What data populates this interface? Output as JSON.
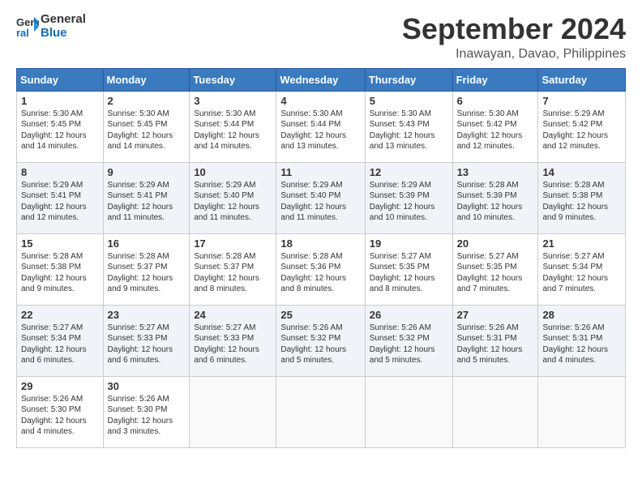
{
  "logo": {
    "line1": "General",
    "line2": "Blue"
  },
  "header": {
    "title": "September 2024",
    "location": "Inawayan, Davao, Philippines"
  },
  "days_of_week": [
    "Sunday",
    "Monday",
    "Tuesday",
    "Wednesday",
    "Thursday",
    "Friday",
    "Saturday"
  ],
  "weeks": [
    [
      {
        "day": "1",
        "info": "Sunrise: 5:30 AM\nSunset: 5:45 PM\nDaylight: 12 hours\nand 14 minutes."
      },
      {
        "day": "2",
        "info": "Sunrise: 5:30 AM\nSunset: 5:45 PM\nDaylight: 12 hours\nand 14 minutes."
      },
      {
        "day": "3",
        "info": "Sunrise: 5:30 AM\nSunset: 5:44 PM\nDaylight: 12 hours\nand 14 minutes."
      },
      {
        "day": "4",
        "info": "Sunrise: 5:30 AM\nSunset: 5:44 PM\nDaylight: 12 hours\nand 13 minutes."
      },
      {
        "day": "5",
        "info": "Sunrise: 5:30 AM\nSunset: 5:43 PM\nDaylight: 12 hours\nand 13 minutes."
      },
      {
        "day": "6",
        "info": "Sunrise: 5:30 AM\nSunset: 5:42 PM\nDaylight: 12 hours\nand 12 minutes."
      },
      {
        "day": "7",
        "info": "Sunrise: 5:29 AM\nSunset: 5:42 PM\nDaylight: 12 hours\nand 12 minutes."
      }
    ],
    [
      {
        "day": "8",
        "info": "Sunrise: 5:29 AM\nSunset: 5:41 PM\nDaylight: 12 hours\nand 12 minutes."
      },
      {
        "day": "9",
        "info": "Sunrise: 5:29 AM\nSunset: 5:41 PM\nDaylight: 12 hours\nand 11 minutes."
      },
      {
        "day": "10",
        "info": "Sunrise: 5:29 AM\nSunset: 5:40 PM\nDaylight: 12 hours\nand 11 minutes."
      },
      {
        "day": "11",
        "info": "Sunrise: 5:29 AM\nSunset: 5:40 PM\nDaylight: 12 hours\nand 11 minutes."
      },
      {
        "day": "12",
        "info": "Sunrise: 5:29 AM\nSunset: 5:39 PM\nDaylight: 12 hours\nand 10 minutes."
      },
      {
        "day": "13",
        "info": "Sunrise: 5:28 AM\nSunset: 5:39 PM\nDaylight: 12 hours\nand 10 minutes."
      },
      {
        "day": "14",
        "info": "Sunrise: 5:28 AM\nSunset: 5:38 PM\nDaylight: 12 hours\nand 9 minutes."
      }
    ],
    [
      {
        "day": "15",
        "info": "Sunrise: 5:28 AM\nSunset: 5:38 PM\nDaylight: 12 hours\nand 9 minutes."
      },
      {
        "day": "16",
        "info": "Sunrise: 5:28 AM\nSunset: 5:37 PM\nDaylight: 12 hours\nand 9 minutes."
      },
      {
        "day": "17",
        "info": "Sunrise: 5:28 AM\nSunset: 5:37 PM\nDaylight: 12 hours\nand 8 minutes."
      },
      {
        "day": "18",
        "info": "Sunrise: 5:28 AM\nSunset: 5:36 PM\nDaylight: 12 hours\nand 8 minutes."
      },
      {
        "day": "19",
        "info": "Sunrise: 5:27 AM\nSunset: 5:35 PM\nDaylight: 12 hours\nand 8 minutes."
      },
      {
        "day": "20",
        "info": "Sunrise: 5:27 AM\nSunset: 5:35 PM\nDaylight: 12 hours\nand 7 minutes."
      },
      {
        "day": "21",
        "info": "Sunrise: 5:27 AM\nSunset: 5:34 PM\nDaylight: 12 hours\nand 7 minutes."
      }
    ],
    [
      {
        "day": "22",
        "info": "Sunrise: 5:27 AM\nSunset: 5:34 PM\nDaylight: 12 hours\nand 6 minutes."
      },
      {
        "day": "23",
        "info": "Sunrise: 5:27 AM\nSunset: 5:33 PM\nDaylight: 12 hours\nand 6 minutes."
      },
      {
        "day": "24",
        "info": "Sunrise: 5:27 AM\nSunset: 5:33 PM\nDaylight: 12 hours\nand 6 minutes."
      },
      {
        "day": "25",
        "info": "Sunrise: 5:26 AM\nSunset: 5:32 PM\nDaylight: 12 hours\nand 5 minutes."
      },
      {
        "day": "26",
        "info": "Sunrise: 5:26 AM\nSunset: 5:32 PM\nDaylight: 12 hours\nand 5 minutes."
      },
      {
        "day": "27",
        "info": "Sunrise: 5:26 AM\nSunset: 5:31 PM\nDaylight: 12 hours\nand 5 minutes."
      },
      {
        "day": "28",
        "info": "Sunrise: 5:26 AM\nSunset: 5:31 PM\nDaylight: 12 hours\nand 4 minutes."
      }
    ],
    [
      {
        "day": "29",
        "info": "Sunrise: 5:26 AM\nSunset: 5:30 PM\nDaylight: 12 hours\nand 4 minutes."
      },
      {
        "day": "30",
        "info": "Sunrise: 5:26 AM\nSunset: 5:30 PM\nDaylight: 12 hours\nand 3 minutes."
      },
      {
        "day": "",
        "info": ""
      },
      {
        "day": "",
        "info": ""
      },
      {
        "day": "",
        "info": ""
      },
      {
        "day": "",
        "info": ""
      },
      {
        "day": "",
        "info": ""
      }
    ]
  ]
}
